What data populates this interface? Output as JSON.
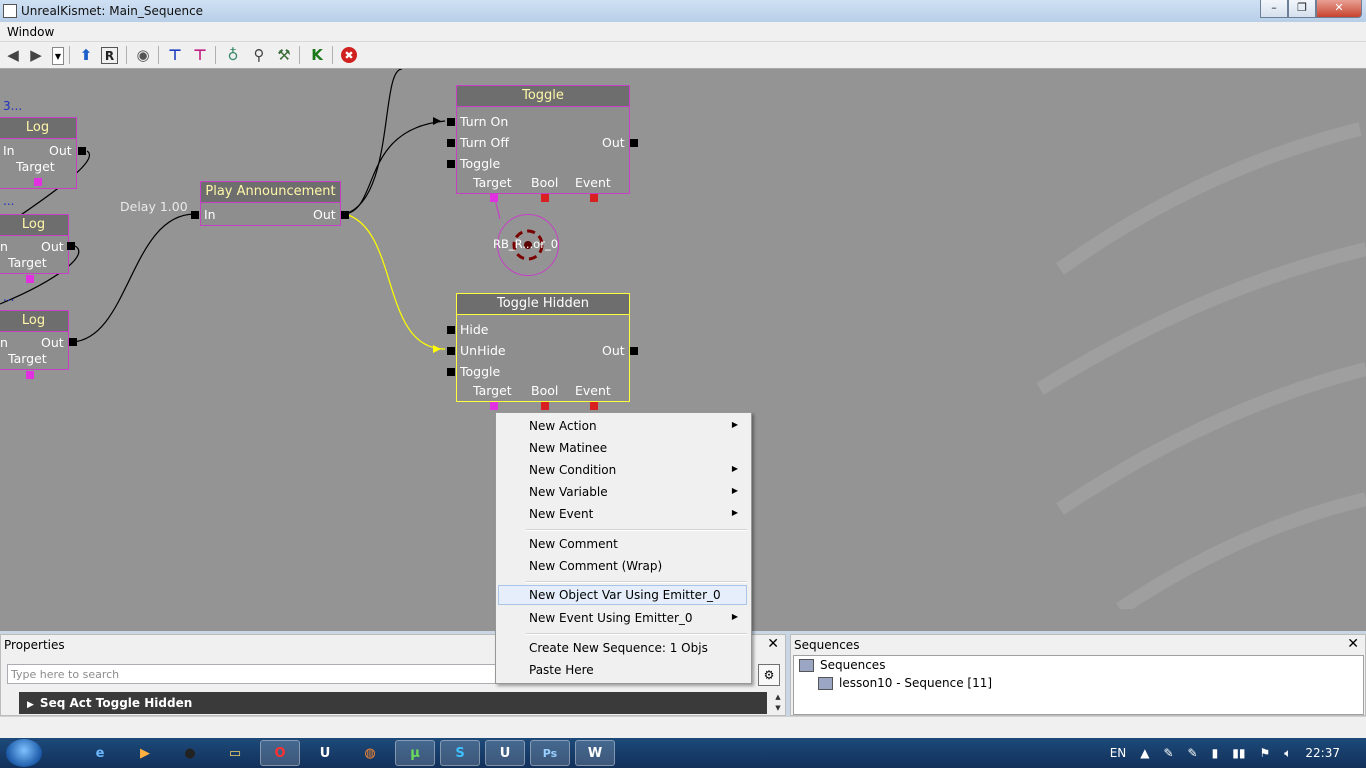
{
  "window": {
    "title": "UnrealKismet: Main_Sequence",
    "minimize": "–",
    "maximize": "❐",
    "close": "✕"
  },
  "menubar": {
    "window_label": "Window"
  },
  "toolbar": {
    "buttons": [
      {
        "name": "back-arrow-icon",
        "glyph": "◀"
      },
      {
        "name": "forward-arrow-icon",
        "glyph": "▶"
      },
      {
        "name": "dropdown-icon",
        "glyph": "▼"
      },
      {
        "name": "up-arrow-icon",
        "glyph": "⬆"
      },
      {
        "name": "r-icon",
        "glyph": "R"
      },
      {
        "name": "eye-icon",
        "glyph": "◉"
      },
      {
        "name": "layout-icon-1",
        "glyph": "⊤"
      },
      {
        "name": "layout-icon-2",
        "glyph": "⊤"
      },
      {
        "name": "bulb-icon",
        "glyph": "♁"
      },
      {
        "name": "zoom-icon",
        "glyph": "⚲"
      },
      {
        "name": "wand-icon",
        "glyph": "⚒"
      },
      {
        "name": "k-icon",
        "glyph": "K"
      },
      {
        "name": "stop-icon",
        "glyph": "✖"
      }
    ]
  },
  "canvas": {
    "dots_top": "3...",
    "dots_mid": "...",
    "dots_low": "...",
    "delay_label": "Delay 1.00",
    "nodes": {
      "log1": {
        "title": "Log",
        "in": "In",
        "out": "Out",
        "target": "Target"
      },
      "log2": {
        "title": "Log",
        "in": "n",
        "out": "Out",
        "target": "Target"
      },
      "log3": {
        "title": "Log",
        "in": "n",
        "out": "Out",
        "target": "Target"
      },
      "play": {
        "title": "Play Announcement",
        "in": "In",
        "out": "Out"
      },
      "toggle": {
        "title": "Toggle",
        "in1": "Turn On",
        "in2": "Turn Off",
        "in3": "Toggle",
        "out": "Out",
        "v1": "Target",
        "v2": "Bool",
        "v3": "Event"
      },
      "toggle_hidden": {
        "title": "Toggle Hidden",
        "in1": "Hide",
        "in2": "UnHide",
        "in3": "Toggle",
        "out": "Out",
        "v1": "Target",
        "v2": "Bool",
        "v3": "Event"
      }
    },
    "variable_label": "RB_R...or_0"
  },
  "context_menu": {
    "items": [
      {
        "label": "New Action",
        "submenu": true
      },
      {
        "label": "New Matinee",
        "submenu": false
      },
      {
        "label": "New Condition",
        "submenu": true
      },
      {
        "label": "New Variable",
        "submenu": true
      },
      {
        "label": "New Event",
        "submenu": true
      },
      {
        "label": "New Comment",
        "submenu": false
      },
      {
        "label": "New Comment (Wrap)",
        "submenu": false
      },
      {
        "label": "New Object Var Using Emitter_0",
        "submenu": false
      },
      {
        "label": "New Event Using Emitter_0",
        "submenu": true
      },
      {
        "label": "Create New Sequence: 1 Objs",
        "submenu": false
      },
      {
        "label": "Paste Here",
        "submenu": false
      }
    ],
    "arrow": "▶"
  },
  "properties": {
    "title": "Properties",
    "search_placeholder": "Type here to search",
    "category": "Seq Act Toggle Hidden",
    "close": "✕"
  },
  "sequences": {
    "title": "Sequences",
    "root": "Sequences",
    "child": "lesson10 - Sequence [11]",
    "close": "✕"
  },
  "taskbar": {
    "apps": [
      {
        "name": "ie-icon",
        "glyph": "e"
      },
      {
        "name": "media-player-icon",
        "glyph": "▶"
      },
      {
        "name": "game-icon",
        "glyph": "●"
      },
      {
        "name": "explorer-icon",
        "glyph": "▭"
      },
      {
        "name": "opera-icon",
        "glyph": "O"
      },
      {
        "name": "unreal-icon-1",
        "glyph": "U"
      },
      {
        "name": "firefox-icon",
        "glyph": "◍"
      },
      {
        "name": "utorrent-icon",
        "glyph": "µ"
      },
      {
        "name": "skype-icon",
        "glyph": "S"
      },
      {
        "name": "unreal-icon-2",
        "glyph": "U"
      },
      {
        "name": "photoshop-icon",
        "glyph": "Ps"
      },
      {
        "name": "word-icon",
        "glyph": "W"
      }
    ],
    "lang": "EN",
    "clock": "22:37",
    "colors": {
      "opera": "#cc1010",
      "skype": "#1ba5e0",
      "photoshop": "#1b3f7a",
      "word": "#2b5ca8",
      "utorrent": "#3a8a2a",
      "explorer": "#d9b24a",
      "firefox": "#e07020"
    }
  },
  "colors": {
    "canvas_bg": "#949494",
    "node_border": "#c640c6",
    "selected_border": "#ffff40",
    "wire_black": "#000000",
    "wire_yellow": "#ffff00"
  }
}
